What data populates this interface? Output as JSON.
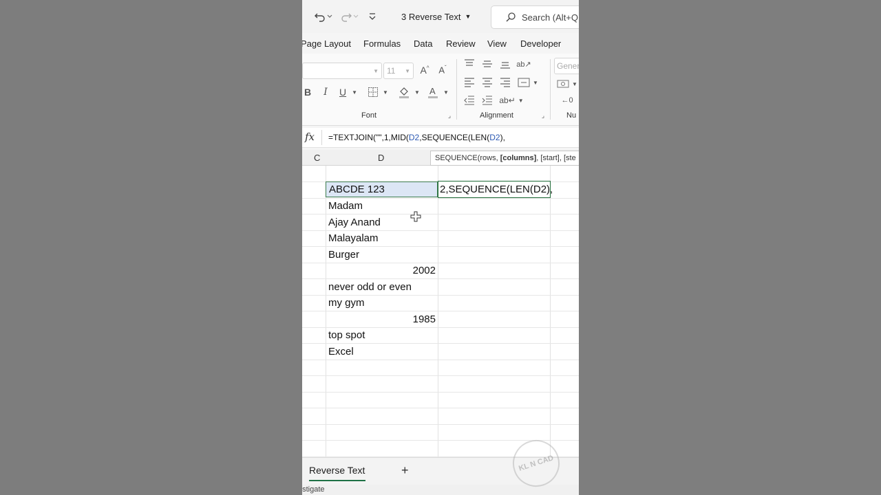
{
  "titlebar": {
    "doc_title": "3 Reverse Text",
    "search_label": "Search (Alt+Q"
  },
  "ribbon_tabs": [
    "Page Layout",
    "Formulas",
    "Data",
    "Review",
    "View",
    "Developer"
  ],
  "ribbon": {
    "font_size": "11",
    "number_format": "Genera",
    "font_group_label": "Font",
    "alignment_group_label": "Alignment",
    "number_group_label": "Nu"
  },
  "formula_bar": {
    "fx_label": "fx",
    "part1": "=TEXTJOIN(\"\",1,MID(",
    "ref1": "D2",
    "part2": ",SEQUENCE(LEN(",
    "ref2": "D2",
    "part3": "),"
  },
  "tooltip": {
    "pre": "SEQUENCE(rows, ",
    "bold": "[columns]",
    "post": ", [start], [ste"
  },
  "columns": [
    "C",
    "D"
  ],
  "cells": [
    {
      "text": "ABCDE 123",
      "align": "left"
    },
    {
      "text": "Madam",
      "align": "left"
    },
    {
      "text": "Ajay Anand",
      "align": "left"
    },
    {
      "text": "Malayalam",
      "align": "left"
    },
    {
      "text": "Burger",
      "align": "left"
    },
    {
      "text": "2002",
      "align": "right"
    },
    {
      "text": "never odd or even",
      "align": "left"
    },
    {
      "text": "my gym",
      "align": "left"
    },
    {
      "text": "1985",
      "align": "right"
    },
    {
      "text": "top spot",
      "align": "left"
    },
    {
      "text": "Excel",
      "align": "left"
    }
  ],
  "edit_cell_text": "2,SEQUENCE(LEN(D2),",
  "sheet_tab": "Reverse Text",
  "add_sheet": "+",
  "status_text": "estigate",
  "watermark": "KL N CAD"
}
